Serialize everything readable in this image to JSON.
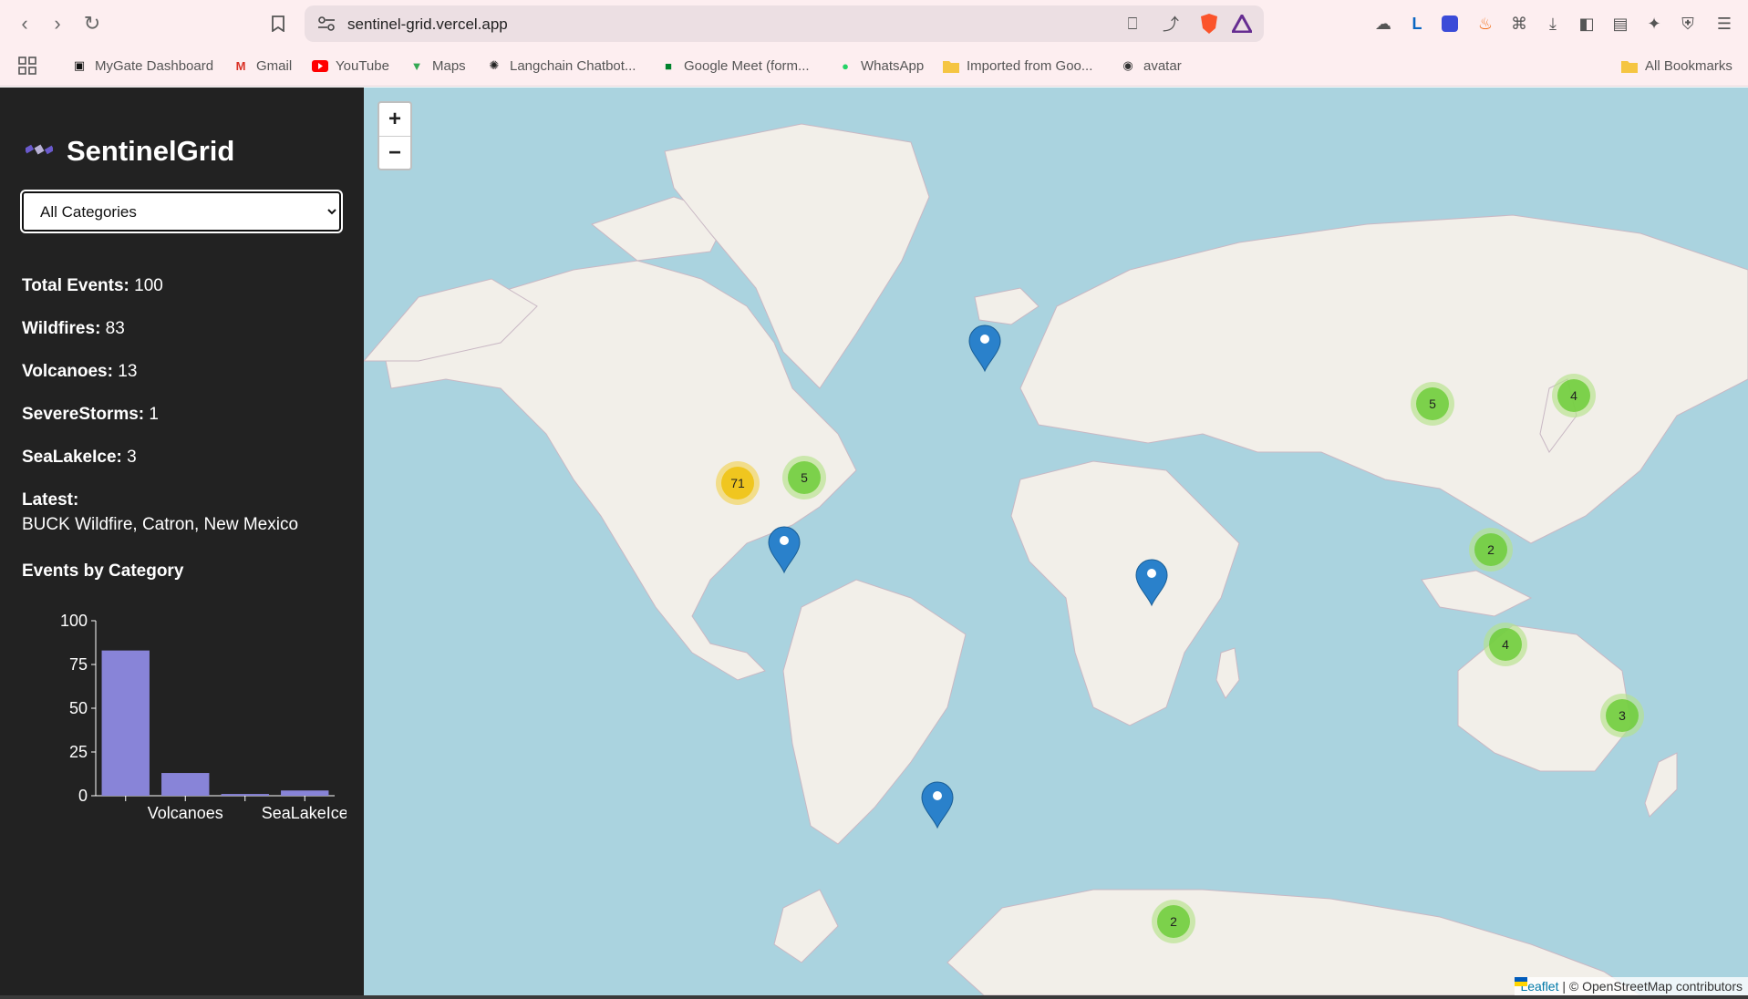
{
  "browser": {
    "url": "sentinel-grid.vercel.app",
    "bookmarks": [
      {
        "label": "MyGate Dashboard"
      },
      {
        "label": "Gmail"
      },
      {
        "label": "YouTube"
      },
      {
        "label": "Maps"
      },
      {
        "label": "Langchain Chatbot..."
      },
      {
        "label": "Google Meet (form..."
      },
      {
        "label": "WhatsApp"
      },
      {
        "label": "Imported from Goo..."
      },
      {
        "label": "avatar"
      }
    ],
    "all_bookmarks": "All Bookmarks"
  },
  "sidebar": {
    "title": "SentinelGrid",
    "logo_icon": "satellite-icon",
    "category_select": {
      "selected": "All Categories"
    },
    "stats": {
      "total": {
        "label": "Total Events:",
        "value": "100"
      },
      "wildfires": {
        "label": "Wildfires:",
        "value": "83"
      },
      "volcanoes": {
        "label": "Volcanoes:",
        "value": "13"
      },
      "severe_storms": {
        "label": "SevereStorms:",
        "value": "1"
      },
      "sea_lake_ice": {
        "label": "SeaLakeIce:",
        "value": "3"
      }
    },
    "latest": {
      "label": "Latest:",
      "value": "BUCK Wildfire, Catron, New Mexico"
    },
    "chart_title": "Events by Category"
  },
  "chart_data": {
    "type": "bar",
    "categories": [
      "Wildfires",
      "Volcanoes",
      "SevereStorms",
      "SeaLakeIce"
    ],
    "visible_tick_labels": [
      "",
      "Volcanoes",
      "",
      "SeaLakeIce"
    ],
    "values": [
      83,
      13,
      1,
      3
    ],
    "yticks": [
      "0",
      "25",
      "50",
      "75",
      "100"
    ],
    "ylim": [
      0,
      100
    ],
    "bar_color": "#8884d8"
  },
  "map": {
    "zoom_in": "+",
    "zoom_out": "−",
    "clusters": [
      {
        "count": "71",
        "size": "medium"
      },
      {
        "count": "5",
        "size": "small"
      },
      {
        "count": "5",
        "size": "small"
      },
      {
        "count": "4",
        "size": "small"
      },
      {
        "count": "2",
        "size": "small"
      },
      {
        "count": "4",
        "size": "small"
      },
      {
        "count": "3",
        "size": "small"
      },
      {
        "count": "2",
        "size": "small"
      }
    ],
    "attribution": {
      "leaflet": "Leaflet",
      "rest": " | © OpenStreetMap contributors"
    },
    "colors": {
      "water": "#aad3df",
      "land": "#f2efe9",
      "marker": "#2a81cb"
    }
  }
}
